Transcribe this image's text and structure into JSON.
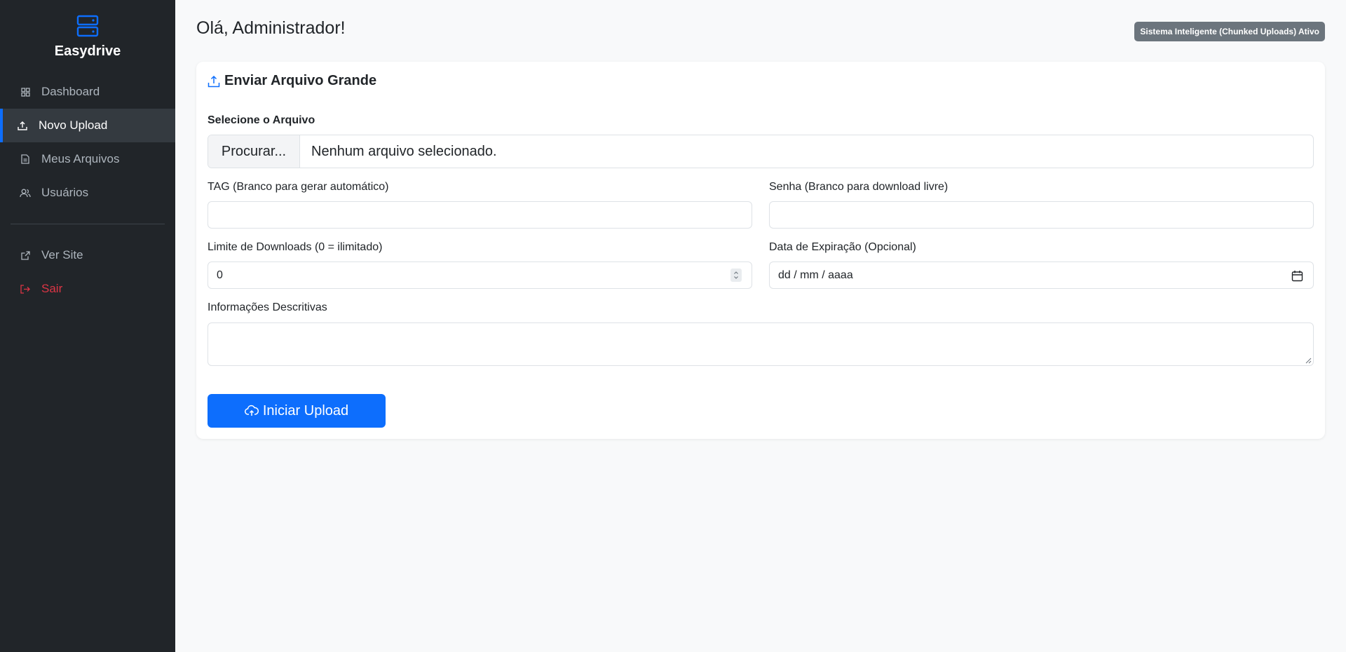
{
  "app": {
    "name": "Easydrive"
  },
  "sidebar": {
    "items": [
      {
        "label": "Dashboard",
        "icon": "grid-icon"
      },
      {
        "label": "Novo Upload",
        "icon": "upload-icon",
        "active": true
      },
      {
        "label": "Meus Arquivos",
        "icon": "file-icon"
      },
      {
        "label": "Usuários",
        "icon": "users-icon"
      }
    ],
    "secondary": [
      {
        "label": "Ver Site",
        "icon": "external-link-icon"
      },
      {
        "label": "Sair",
        "icon": "logout-icon",
        "color": "#dc3545"
      }
    ]
  },
  "header": {
    "greeting": "Olá, Administrador!",
    "status_badge": "Sistema Inteligente (Chunked Uploads) Ativo"
  },
  "form": {
    "title": "Enviar Arquivo Grande",
    "file_label": "Selecione o Arquivo",
    "file_button": "Procurar...",
    "file_status": "Nenhum arquivo selecionado.",
    "tag_label": "TAG (Branco para gerar automático)",
    "tag_value": "",
    "password_label": "Senha (Branco para download livre)",
    "password_value": "",
    "limit_label": "Limite de Downloads (0 = ilimitado)",
    "limit_value": "0",
    "expiry_label": "Data de Expiração (Opcional)",
    "expiry_placeholder": "dd / mm / aaaa",
    "info_label": "Informações Descritivas",
    "info_value": "",
    "submit_label": "Iniciar Upload"
  },
  "colors": {
    "sidebar_bg": "#212529",
    "accent": "#0d6efd",
    "danger": "#dc3545",
    "badge_bg": "#6c757d"
  }
}
